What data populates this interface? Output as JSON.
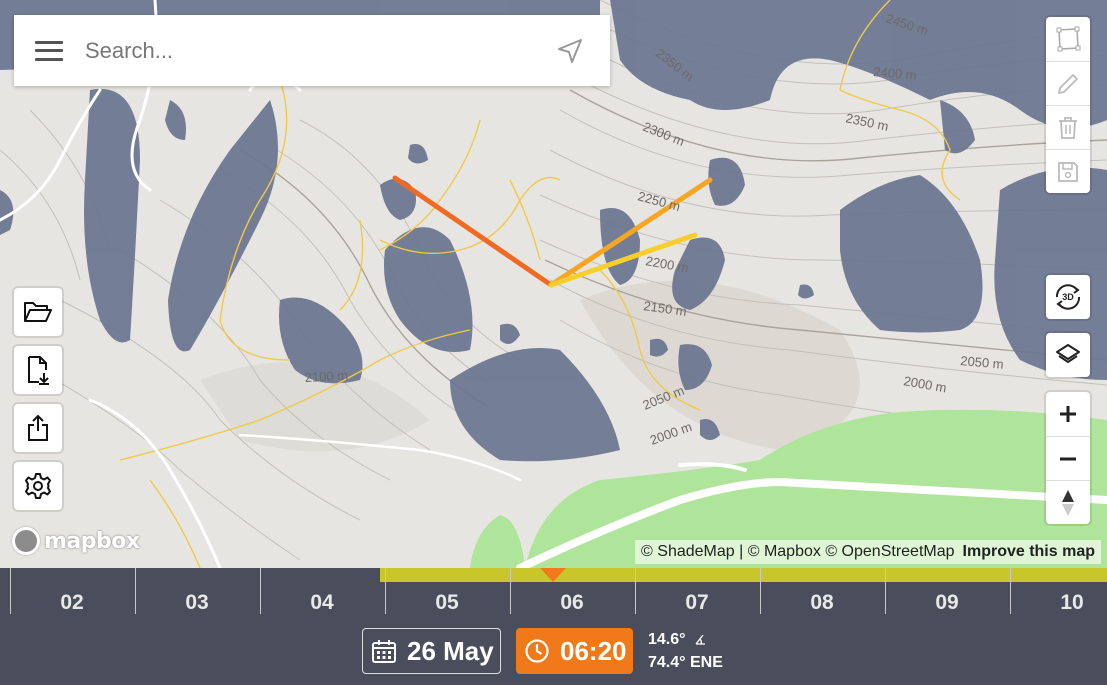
{
  "search": {
    "placeholder": "Search..."
  },
  "map": {
    "contour_labels": [
      "2450 m",
      "2400 m",
      "2350 m",
      "2350 m",
      "2300 m",
      "2250 m",
      "2200 m",
      "2150 m",
      "2100 m",
      "2050 m",
      "2050 m",
      "2000 m",
      "2000 m"
    ],
    "colors": {
      "shadow": "#6b7590",
      "terrain": "#e7e5e1",
      "forest": "#aee59a",
      "trail": "#f0c94a",
      "sun_line_sunrise": "#f06a24",
      "sun_line_current": "#f5a623",
      "sun_line_sunset": "#f8cf2a"
    },
    "logo_text": "mapbox",
    "attribution": {
      "text": "© ShadeMap | © Mapbox © OpenStreetMap",
      "improve_link": "Improve this map"
    }
  },
  "controls": {
    "draw": [
      "polygon-icon",
      "pencil-icon",
      "trash-icon",
      "save-icon"
    ],
    "view": [
      "rotate-3d-icon",
      "layers-icon"
    ],
    "zoom": [
      "plus-icon",
      "minus-icon",
      "compass-icon"
    ],
    "left": [
      "folder-open-icon",
      "file-download-icon",
      "share-icon",
      "settings-icon"
    ]
  },
  "timeline": {
    "hours": [
      "02",
      "03",
      "04",
      "05",
      "06",
      "07",
      "08",
      "09",
      "10"
    ],
    "date": "26 May",
    "time": "06:20",
    "sun_elevation": "14.6°",
    "sun_azimuth": "74.4° ENE",
    "colors": {
      "bar": "#4a4e5c",
      "daylight": "#c9c62a",
      "accent": "#f07a1a"
    }
  }
}
